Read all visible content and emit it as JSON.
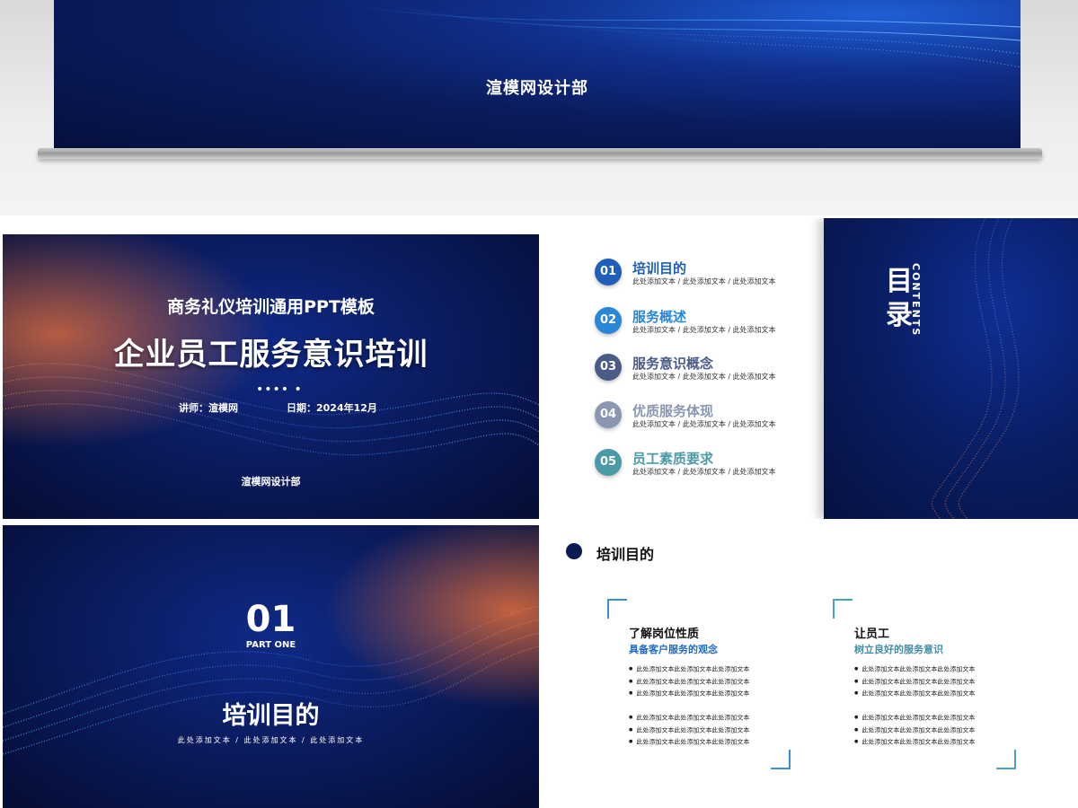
{
  "top_preview": {
    "dept": "渲模网设计部"
  },
  "cover": {
    "subtitle": "商务礼仪培训通用PPT模板",
    "title": "企业员工服务意识培训",
    "dots": "•••• •",
    "lecturer": "讲师：渲模网",
    "date": "日期：2024年12月",
    "dept": "渲模网设计部"
  },
  "toc": {
    "heading_cn": "目录",
    "heading_en": "CONTENTS",
    "items": [
      {
        "num": "01",
        "title": "培训目的",
        "desc": "此处添加文本 / 此处添加文本 / 此处添加文本",
        "color": "#1f5fb8"
      },
      {
        "num": "02",
        "title": "服务概述",
        "desc": "此处添加文本 / 此处添加文本 / 此处添加文本",
        "color": "#2a86d6"
      },
      {
        "num": "03",
        "title": "服务意识概念",
        "desc": "此处添加文本 / 此处添加文本 / 此处添加文本",
        "color": "#4a5c86"
      },
      {
        "num": "04",
        "title": "优质服务体现",
        "desc": "此处添加文本 / 此处添加文本 / 此处添加文本",
        "color": "#8a97b2"
      },
      {
        "num": "05",
        "title": "员工素质要求",
        "desc": "此处添加文本 / 此处添加文本 / 此处添加文本",
        "color": "#4a9aa8"
      }
    ]
  },
  "section": {
    "num": "01",
    "part": "PART ONE",
    "title": "培训目的",
    "desc": "此处添加文本 / 此处添加文本 / 此处添加文本"
  },
  "content": {
    "heading": "培训目的",
    "cards": [
      {
        "h1": "了解岗位性质",
        "h2": "具备客户服务的观念",
        "bullets_a": [
          "此处添加文本此处添加文本此处添加文本",
          "此处添加文本此处添加文本此处添加文本",
          "此处添加文本此处添加文本此处添加文本"
        ],
        "bullets_b": [
          "此处添加文本此处添加文本此处添加文本",
          "此处添加文本此处添加文本此处添加文本",
          "此处添加文本此处添加文本此处添加文本"
        ]
      },
      {
        "h1": "让员工",
        "h2": "树立良好的服务意识",
        "bullets_a": [
          "此处添加文本此处添加文本此处添加文本",
          "此处添加文本此处添加文本此处添加文本",
          "此处添加文本此处添加文本此处添加文本"
        ],
        "bullets_b": [
          "此处添加文本此处添加文本此处添加文本",
          "此处添加文本此处添加文本此处添加文本",
          "此处添加文本此处添加文本此处添加文本"
        ]
      }
    ]
  }
}
